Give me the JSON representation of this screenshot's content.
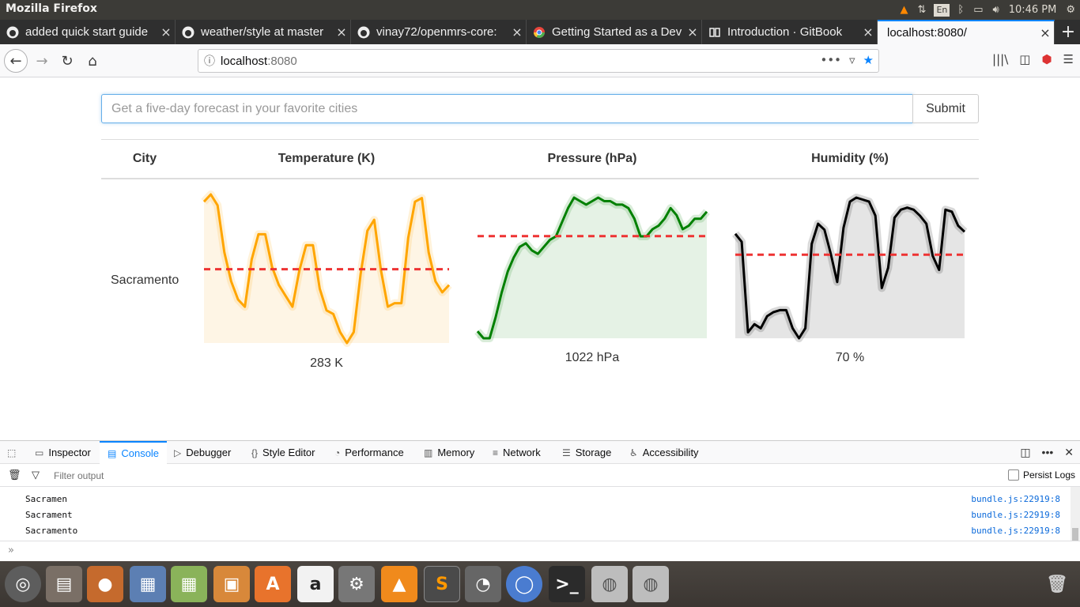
{
  "os": {
    "window_title": "Mozilla Firefox",
    "lang": "En",
    "time": "10:46 PM"
  },
  "tabs": [
    {
      "label": "added quick start guide",
      "icon": "github-icon"
    },
    {
      "label": "weather/style at master",
      "icon": "github-icon"
    },
    {
      "label": "vinay72/openmrs-core:",
      "icon": "github-icon"
    },
    {
      "label": "Getting Started as a Dev",
      "icon": "chrome-icon"
    },
    {
      "label": "Introduction · GitBook",
      "icon": "gitbook-icon"
    },
    {
      "label": "localhost:8080/",
      "icon": ""
    }
  ],
  "urlbar": {
    "host": "localhost",
    "port": ":8080"
  },
  "page": {
    "search_placeholder": "Get a five-day forecast in your favorite cities",
    "submit_label": "Submit",
    "headers": {
      "city": "City",
      "temperature": "Temperature (K)",
      "pressure": "Pressure (hPa)",
      "humidity": "Humidity (%)"
    },
    "row": {
      "city": "Sacramento",
      "temperature_avg": "283 K",
      "pressure_avg": "1022 hPa",
      "humidity_avg": "70 %"
    }
  },
  "chart_data": [
    {
      "type": "line",
      "name": "temperature",
      "color": "#ffa500",
      "fill": "#fef5e5",
      "reference_line": "average",
      "values": [
        299,
        301,
        298,
        285,
        277,
        272,
        270,
        283,
        290,
        290,
        281,
        276,
        273,
        270,
        280,
        287,
        287,
        275,
        269,
        268,
        263,
        260,
        263,
        279,
        291,
        294,
        280,
        270,
        271,
        271,
        289,
        299,
        300,
        285,
        277,
        274,
        276
      ]
    },
    {
      "type": "line",
      "name": "pressure",
      "color": "#008000",
      "fill": "#e5f2e5",
      "reference_line": "average",
      "values": [
        1000,
        998,
        998,
        1004,
        1011,
        1017,
        1021,
        1024,
        1025,
        1023,
        1022,
        1024,
        1026,
        1027,
        1031,
        1035,
        1038,
        1037,
        1036,
        1037,
        1038,
        1037,
        1037,
        1036,
        1036,
        1035,
        1032,
        1027,
        1027,
        1029,
        1030,
        1032,
        1035,
        1033,
        1029,
        1030,
        1032,
        1032,
        1034
      ]
    },
    {
      "type": "line",
      "name": "humidity",
      "color": "#000000",
      "fill": "#e5e5e5",
      "reference_line": "average",
      "values": [
        85,
        81,
        36,
        40,
        38,
        44,
        46,
        47,
        47,
        38,
        33,
        38,
        80,
        90,
        87,
        75,
        61,
        88,
        101,
        103,
        102,
        101,
        94,
        58,
        68,
        93,
        97,
        98,
        97,
        94,
        90,
        74,
        67,
        97,
        96,
        89,
        86
      ]
    }
  ],
  "devtools": {
    "tabs": [
      "Inspector",
      "Console",
      "Debugger",
      "Style Editor",
      "Performance",
      "Memory",
      "Network",
      "Storage",
      "Accessibility"
    ],
    "filter_placeholder": "Filter output",
    "persist_logs": "Persist Logs",
    "logs": [
      {
        "message": "Sacramen",
        "source": "bundle.js:22919:8"
      },
      {
        "message": "Sacrament",
        "source": "bundle.js:22919:8"
      },
      {
        "message": "Sacramento",
        "source": "bundle.js:22919:8"
      }
    ],
    "prompt": "»"
  },
  "dock": [
    "ubuntu-icon",
    "files-icon",
    "firefox-icon",
    "document-viewer-icon",
    "spreadsheet-icon",
    "presentation-icon",
    "software-center-icon",
    "amazon-icon",
    "settings-icon",
    "vlc-icon",
    "sublime-icon",
    "disk-usage-icon",
    "chromium-icon",
    "terminal-icon",
    "drive-icon",
    "drive-icon",
    "trash-icon"
  ]
}
